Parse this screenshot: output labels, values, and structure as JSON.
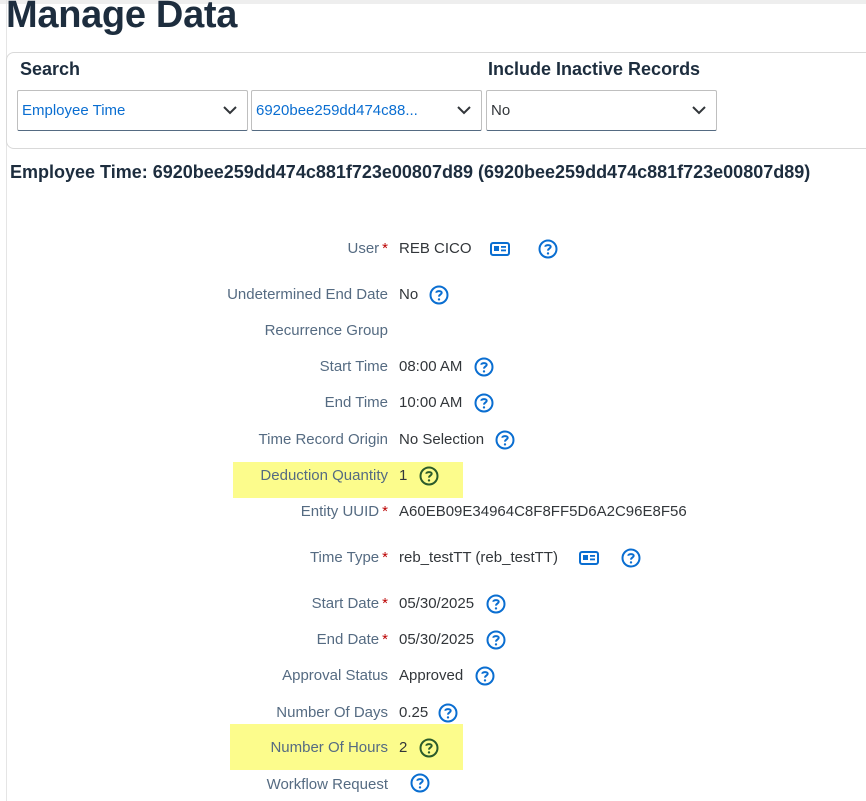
{
  "page": {
    "title": "Manage Data"
  },
  "search_panel": {
    "search_label": "Search",
    "inactive_label": "Include Inactive Records",
    "entity_select": "Employee Time",
    "record_select": "6920bee259dd474c88...",
    "inactive_select": "No"
  },
  "record": {
    "heading": "Employee Time: 6920bee259dd474c881f723e00807d89 (6920bee259dd474c881f723e00807d89)",
    "required_marker": "*",
    "fields": {
      "user": {
        "label": "User",
        "value": "REB CICO"
      },
      "undetermined_end_date": {
        "label": "Undetermined End Date",
        "value": "No"
      },
      "recurrence_group": {
        "label": "Recurrence Group",
        "value": ""
      },
      "start_time": {
        "label": "Start Time",
        "value": "08:00 AM"
      },
      "end_time": {
        "label": "End Time",
        "value": "10:00 AM"
      },
      "time_record_origin": {
        "label": "Time Record Origin",
        "value": "No Selection"
      },
      "deduction_quantity": {
        "label": "Deduction Quantity",
        "value": "1"
      },
      "entity_uuid": {
        "label": "Entity UUID",
        "value": "A60EB09E34964C8F8FF5D6A2C96E8F56"
      },
      "time_type": {
        "label": "Time Type",
        "value": "reb_testTT (reb_testTT)"
      },
      "start_date": {
        "label": "Start Date",
        "value": "05/30/2025"
      },
      "end_date": {
        "label": "End Date",
        "value": "05/30/2025"
      },
      "approval_status": {
        "label": "Approval Status",
        "value": "Approved"
      },
      "number_of_days": {
        "label": "Number Of Days",
        "value": "0.25"
      },
      "number_of_hours": {
        "label": "Number Of Hours",
        "value": "2"
      },
      "workflow_request": {
        "label": "Workflow Request",
        "value": ""
      }
    }
  },
  "colors": {
    "accent": "#0a6ed1",
    "highlight": "#fcfc8c",
    "required": "#bb0000",
    "label": "#556b82",
    "highlighted_icon": "#2b5b2b"
  },
  "icons": {
    "help": "question-circle-icon",
    "card": "contact-card-icon",
    "dropdown": "chevron-down-icon"
  }
}
